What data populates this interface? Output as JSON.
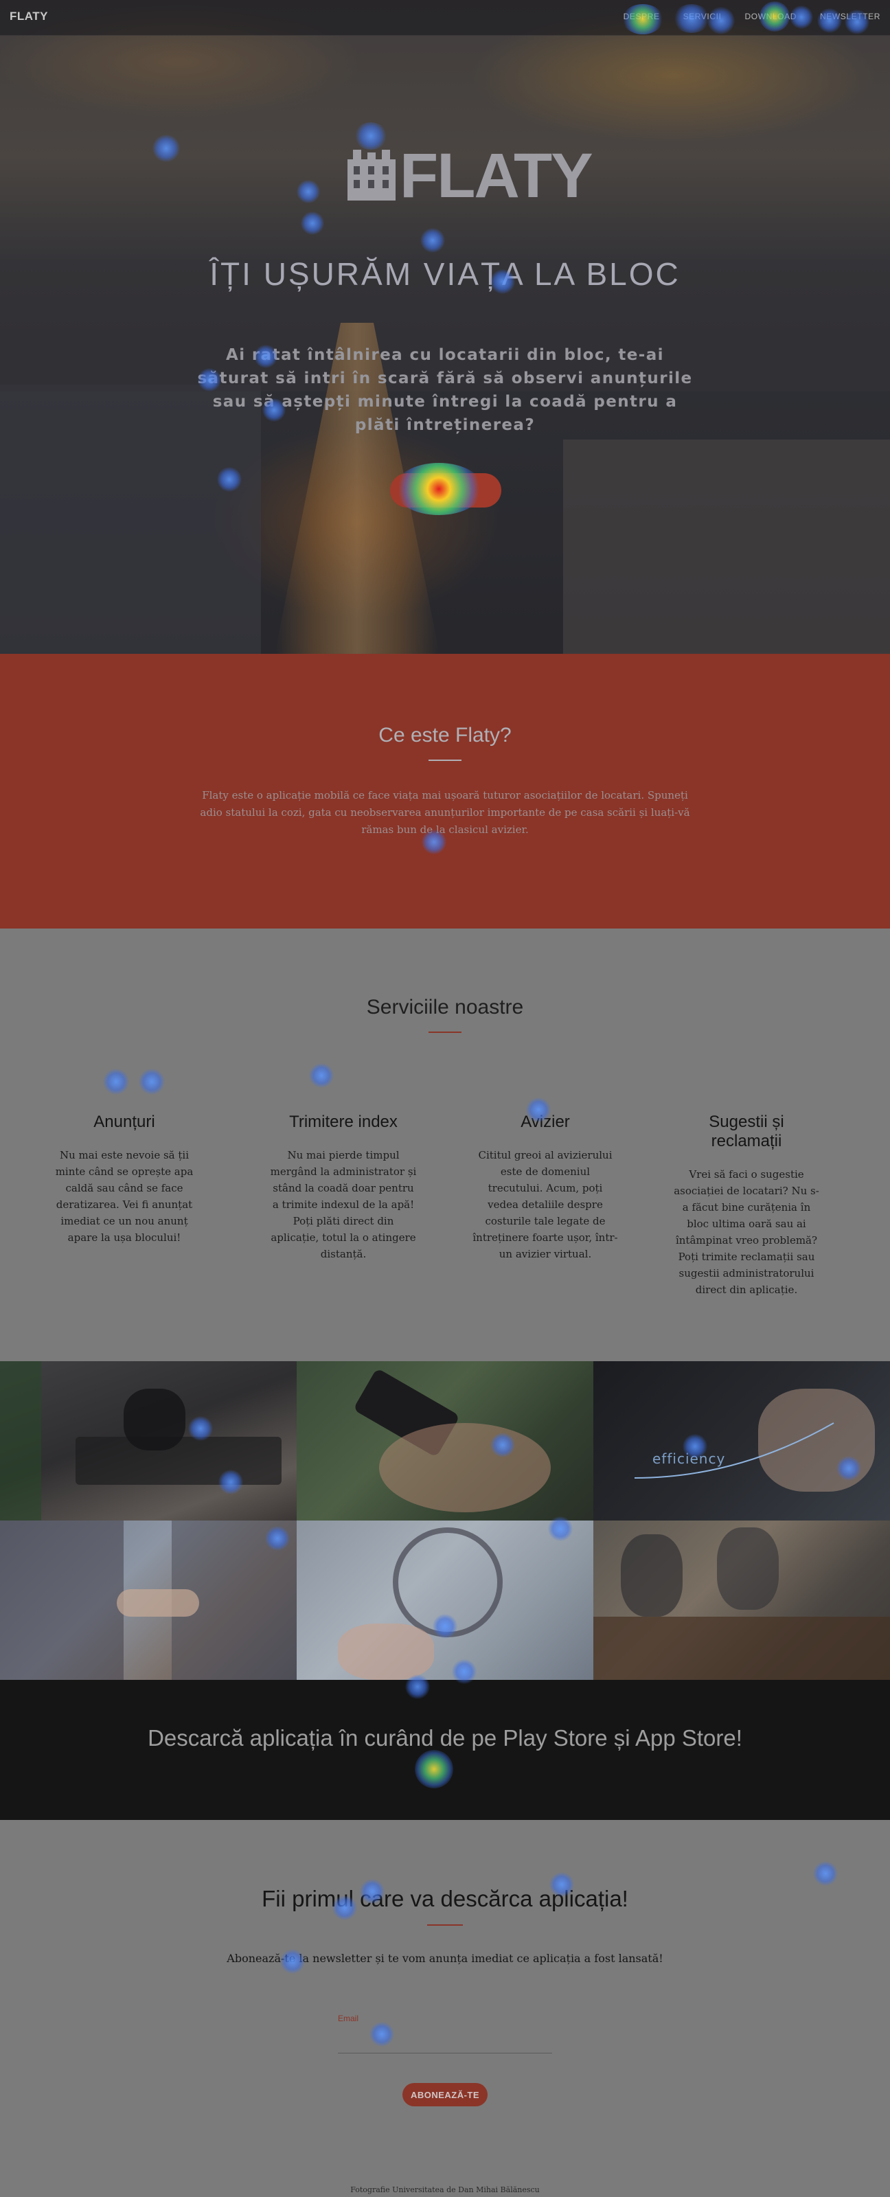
{
  "nav": {
    "brand": "FLATY",
    "items": [
      {
        "label": "DESPRE"
      },
      {
        "label": "SERVICII"
      },
      {
        "label": "DOWNLOAD"
      },
      {
        "label": "NEWSLETTER"
      }
    ]
  },
  "hero": {
    "logo_text": "FLATY",
    "title": "ÎȚI UȘURĂM VIAȚA LA BLOC",
    "lead": "Ai ratat întâlnirea cu locatarii din bloc, te-ai săturat să intri în scară fără să observi anunțurile sau să aștepți minute întregi la coadă pentru a plăti întreținerea?",
    "cta_label": ""
  },
  "about": {
    "title": "Ce este Flaty?",
    "text": "Flaty este o aplicație mobilă ce face viața mai ușoară tuturor asociațiilor de locatari. Spuneți adio statului la cozi, gata cu neobservarea anunțurilor importante de pe casa scării și luați-vă rămas bun de la clasicul avizier."
  },
  "services": {
    "title": "Serviciile noastre",
    "items": [
      {
        "title": "Anunțuri",
        "text": "Nu mai este nevoie să ții minte când se oprește apa caldă sau când se face deratizarea. Vei fi anunțat imediat ce un nou anunț apare la ușa blocului!"
      },
      {
        "title": "Trimitere index",
        "text": "Nu mai pierde timpul mergând la administrator și stând la coadă doar pentru a trimite indexul de la apă! Poți plăti direct din aplicație, totul la o atingere distanță."
      },
      {
        "title": "Avizier",
        "text": "Cititul greoi al avizierului este de domeniul trecutului. Acum, poți vedea detaliile despre costurile tale legate de întreținere foarte ușor, într-un avizier virtual."
      },
      {
        "title": "Sugestii și reclamații",
        "text": "Vrei să faci o sugestie asociației de locatari? Nu s-a făcut bine curățenia în bloc ultima oară sau ai întâmpinat vreo problemă? Poți trimite reclamații sau sugestii administratorului direct din aplicație."
      }
    ]
  },
  "gallery": {
    "efficiency_text": "efficiency"
  },
  "download": {
    "title": "Descarcă aplicația în curând de pe Play Store și App Store!"
  },
  "newsletter": {
    "title": "Fii primul care va descărca aplicația!",
    "text": "Abonează-te la newsletter și te vom anunța imediat ce aplicația a fost lansată!",
    "email_label": "Email",
    "email_value": "",
    "button_label": "ABONEAZĂ-TE",
    "credit": "Fotografie Universitatea de Dan Mihai Bălănescu"
  },
  "colors": {
    "brand_red": "#8a3528",
    "dark_band": "#151515",
    "page_gray": "#7b7b7b"
  }
}
